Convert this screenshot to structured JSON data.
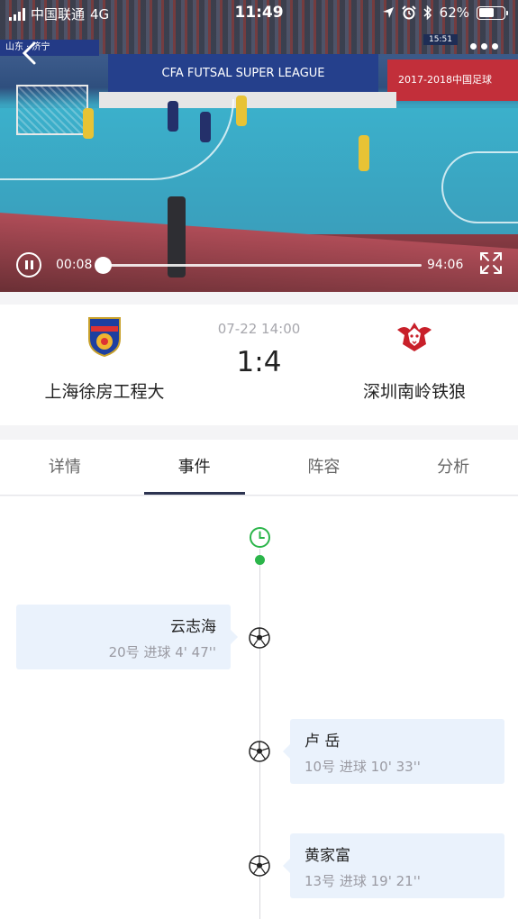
{
  "status_bar": {
    "carrier": "中国联通",
    "network": "4G",
    "time": "11:49",
    "battery": "62%",
    "battery_level": 0.62
  },
  "video": {
    "location_tag": "山东 · 济宁",
    "banner_text": "CFA FUTSAL SUPER LEAGUE",
    "banner_text_right": "2017-2018中国足球",
    "score_chip": "15:51",
    "current_time": "00:08",
    "duration": "94:06",
    "progress_fraction": 0.0014
  },
  "match": {
    "datetime": "07-22 14:00",
    "score": "1:4",
    "home": {
      "name": "上海徐房工程大"
    },
    "away": {
      "name": "深圳南岭铁狼"
    }
  },
  "tabs": [
    {
      "label": "详情",
      "active": false
    },
    {
      "label": "事件",
      "active": true
    },
    {
      "label": "阵容",
      "active": false
    },
    {
      "label": "分析",
      "active": false
    }
  ],
  "events": [
    {
      "side": "home",
      "player": "云志海",
      "detail": "20号 进球 4' 47''"
    },
    {
      "side": "away",
      "player": "卢 岳",
      "detail": "10号 进球 10' 33''"
    },
    {
      "side": "away",
      "player": "黄家富",
      "detail": "13号 进球 19' 21''"
    }
  ],
  "colors": {
    "accent_green": "#2bb54a",
    "tab_indicator": "#2c3350",
    "event_card_bg": "#eaf2fc"
  }
}
